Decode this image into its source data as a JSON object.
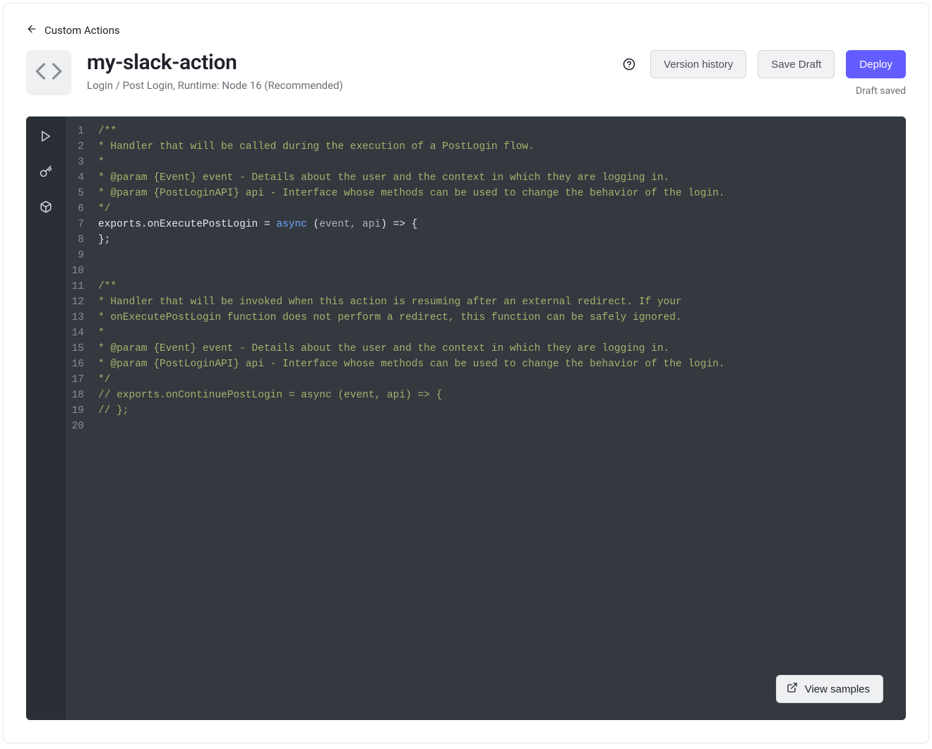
{
  "breadcrumb": {
    "label": "Custom Actions"
  },
  "header": {
    "title": "my-slack-action",
    "subtitle": "Login / Post Login, Runtime: Node 16 (Recommended)"
  },
  "buttons": {
    "version_history": "Version history",
    "save_draft": "Save Draft",
    "deploy": "Deploy",
    "view_samples": "View samples"
  },
  "status": {
    "draft_saved": "Draft saved"
  },
  "icons": {
    "back": "arrow-left-icon",
    "code": "code-brackets-icon",
    "help": "help-circle-icon",
    "play": "play-icon",
    "key": "key-icon",
    "package": "package-icon",
    "external": "external-link-icon"
  },
  "editor": {
    "lines": [
      {
        "type": "comment",
        "text": "/**"
      },
      {
        "type": "comment",
        "text": "* Handler that will be called during the execution of a PostLogin flow."
      },
      {
        "type": "comment",
        "text": "*"
      },
      {
        "type": "comment",
        "text": "* @param {Event} event - Details about the user and the context in which they are logging in."
      },
      {
        "type": "comment",
        "text": "* @param {PostLoginAPI} api - Interface whose methods can be used to change the behavior of the login."
      },
      {
        "type": "comment",
        "text": "*/"
      },
      {
        "type": "code",
        "parts": [
          {
            "cls": "plain",
            "t": "exports.onExecutePostLogin = "
          },
          {
            "cls": "keyword",
            "t": "async"
          },
          {
            "cls": "plain",
            "t": " ("
          },
          {
            "cls": "param",
            "t": "event, api"
          },
          {
            "cls": "plain",
            "t": ") => {"
          }
        ]
      },
      {
        "type": "plain",
        "text": "};"
      },
      {
        "type": "blank",
        "text": ""
      },
      {
        "type": "blank",
        "text": ""
      },
      {
        "type": "comment",
        "text": "/**"
      },
      {
        "type": "comment",
        "text": "* Handler that will be invoked when this action is resuming after an external redirect. If your"
      },
      {
        "type": "comment",
        "text": "* onExecutePostLogin function does not perform a redirect, this function can be safely ignored."
      },
      {
        "type": "comment",
        "text": "*"
      },
      {
        "type": "comment",
        "text": "* @param {Event} event - Details about the user and the context in which they are logging in."
      },
      {
        "type": "comment",
        "text": "* @param {PostLoginAPI} api - Interface whose methods can be used to change the behavior of the login."
      },
      {
        "type": "comment",
        "text": "*/"
      },
      {
        "type": "comment",
        "text": "// exports.onContinuePostLogin = async (event, api) => {"
      },
      {
        "type": "comment",
        "text": "// };"
      },
      {
        "type": "blank",
        "text": ""
      }
    ]
  }
}
